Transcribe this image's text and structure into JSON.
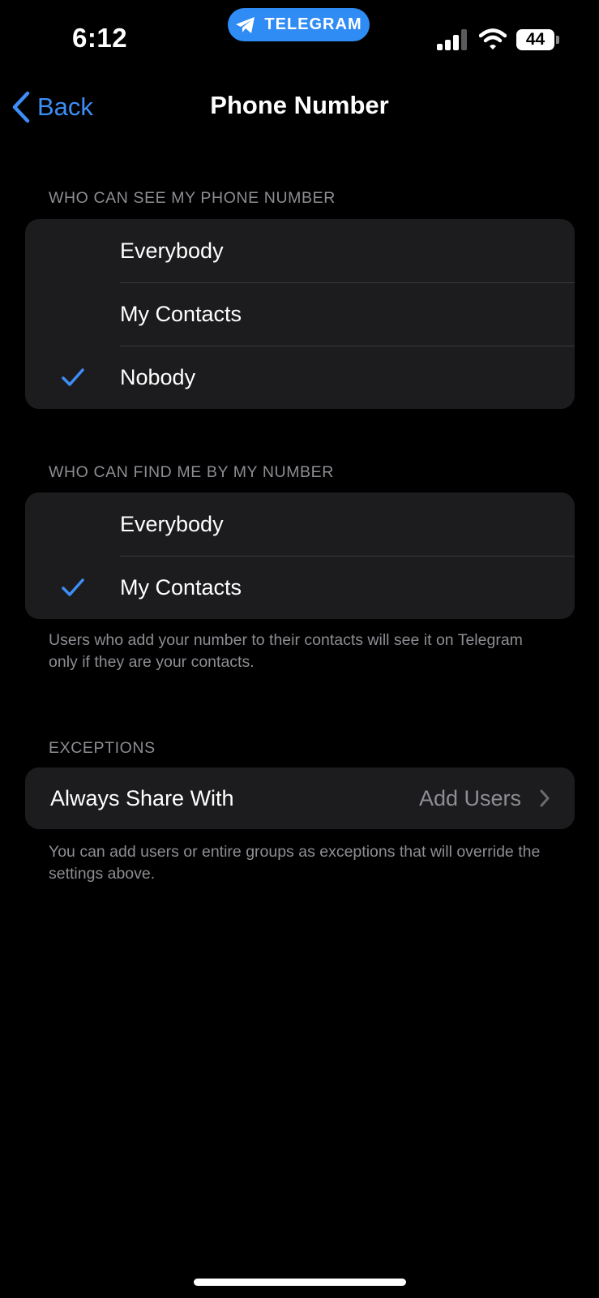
{
  "status_bar": {
    "time": "6:12",
    "app_pill": "TELEGRAM",
    "battery": "44"
  },
  "nav": {
    "back_label": "Back",
    "title": "Phone Number"
  },
  "see_section": {
    "header": "WHO CAN SEE MY PHONE NUMBER",
    "options": [
      {
        "label": "Everybody",
        "checked": false
      },
      {
        "label": "My Contacts",
        "checked": false
      },
      {
        "label": "Nobody",
        "checked": true
      }
    ]
  },
  "find_section": {
    "header": "WHO CAN FIND ME BY MY NUMBER",
    "options": [
      {
        "label": "Everybody",
        "checked": false
      },
      {
        "label": "My Contacts",
        "checked": true
      }
    ],
    "footer": "Users who add your number to their contacts will see it on Telegram only if they are your contacts."
  },
  "exceptions": {
    "header": "EXCEPTIONS",
    "row_label": "Always Share With",
    "row_value": "Add Users",
    "footer": "You can add users or entire groups as exceptions that will override the settings above."
  },
  "colors": {
    "accent": "#3d8ef6",
    "cell_bg": "#1c1c1e",
    "secondary_text": "#8d8d93"
  }
}
